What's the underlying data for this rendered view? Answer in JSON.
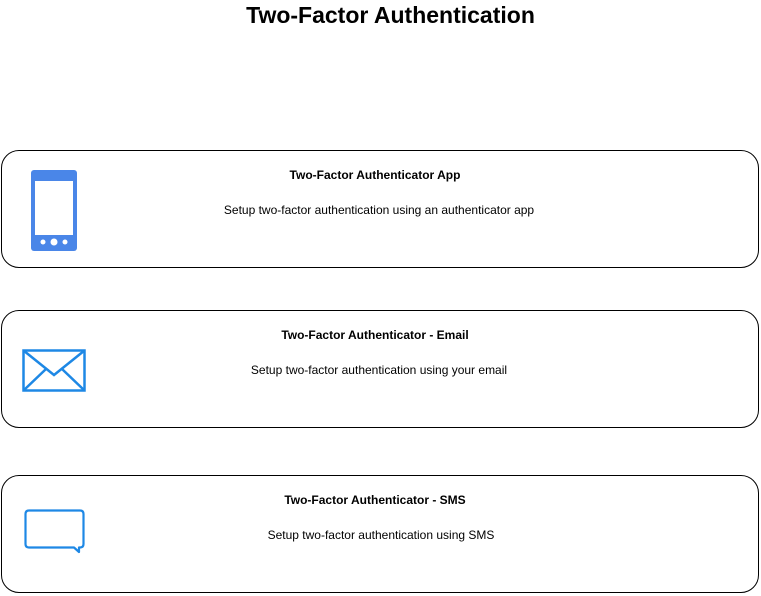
{
  "title": "Two-Factor Authentication",
  "accent_color": "#1e88e5",
  "options": [
    {
      "icon": "mobile-phone-icon",
      "title": "Two-Factor Authenticator App",
      "description": "Setup two-factor authentication using an authenticator app"
    },
    {
      "icon": "envelope-icon",
      "title": "Two-Factor Authenticator - Email",
      "description": "Setup two-factor authentication using your email"
    },
    {
      "icon": "chat-bubble-icon",
      "title": "Two-Factor Authenticator - SMS",
      "description": "Setup two-factor authentication using SMS"
    }
  ]
}
